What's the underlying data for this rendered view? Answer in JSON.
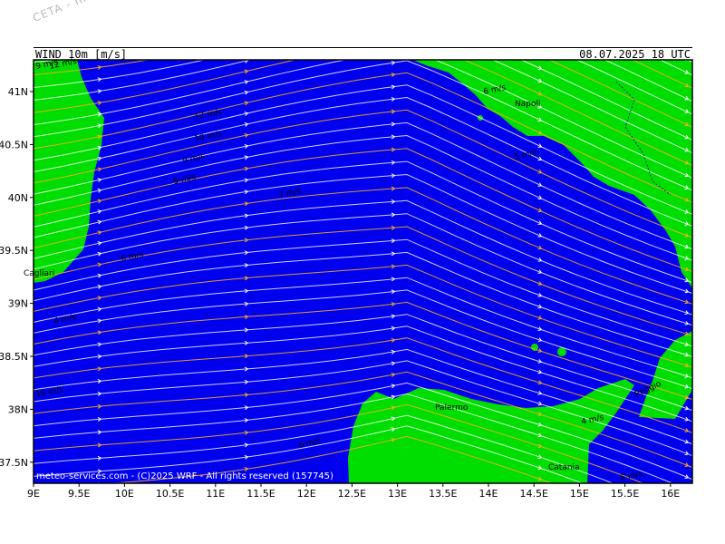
{
  "watermark": "CETA - Inst. f",
  "header": {
    "title": "WIND  10m  [m/s]",
    "date": "08.07.2025  18  UTC"
  },
  "axes": {
    "lat_ticks": [
      "41N",
      "40.5N",
      "40N",
      "39.5N",
      "39N",
      "38.5N",
      "38N",
      "37.5N"
    ],
    "lon_ticks": [
      "9E",
      "9.5E",
      "10E",
      "10.5E",
      "11E",
      "11.5E",
      "12E",
      "12.5E",
      "13E",
      "13.5E",
      "14E",
      "14.5E",
      "15E",
      "15.5E",
      "16E"
    ]
  },
  "colors": {
    "sea": "#0000ee",
    "land": "#00dd00",
    "streamline_strong": "#ffb020",
    "streamline_weak": "#ffffff"
  },
  "speed_labels": [
    "12 m/s",
    "12 m/s",
    "10 m/s",
    "9 m/s",
    "9 m/s",
    "7 m/s",
    "6 m/s",
    "6 m/s",
    "5 m/s",
    "4 m/s",
    "4 m/s",
    "6 m/s",
    "10 m/s",
    "6 m/s",
    "9 m/s"
  ],
  "cities": [
    "Napoli",
    "Cagliari",
    "Palermo",
    "Catania",
    "Reggio"
  ],
  "credit": "meteo-services.com - (C)2025 WRF - All rights reserved (157745)"
}
